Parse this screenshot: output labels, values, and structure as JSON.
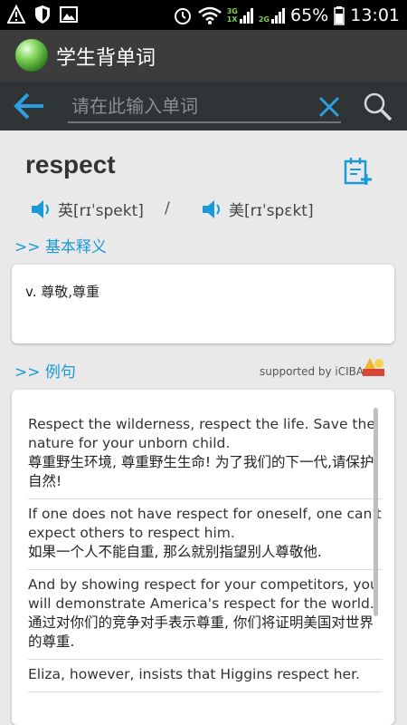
{
  "status_bar": {
    "network_label_top": "3G",
    "network_label_bottom": "1X",
    "network2_label_top": "2G",
    "battery": "65%",
    "time": "13:01"
  },
  "app": {
    "title": "学生背单词"
  },
  "search": {
    "placeholder": "请在此输入单词",
    "value": ""
  },
  "word": {
    "text": "respect",
    "pron_uk": "英[rɪˈspekt]",
    "pron_separator": "/",
    "pron_us": "美[rɪˈspɛkt]"
  },
  "sections": {
    "basic": ">> 基本释义",
    "examples": ">> 例句"
  },
  "definition": "v. 尊敬,尊重",
  "supported_by": "supported by iCIBA",
  "examples": [
    {
      "en": "Respect the wilderness, respect the life. Save the nature for your unborn child.",
      "zh": "尊重野生环境, 尊重野生生命! 为了我们的下一代,请保护自然!"
    },
    {
      "en": "If one does not have respect for oneself, one can't expect others to respect him.",
      "zh": "如果一个人不能自重, 那么就别指望别人尊敬他."
    },
    {
      "en": "And by showing respect for your competitors, you will demonstrate America's respect for the world.",
      "zh": "通过对你们的竞争对手表示尊重, 你们将证明美国对世界的尊重."
    },
    {
      "en": "Eliza, however, insists that Higgins respect her.",
      "zh": ""
    }
  ],
  "colors": {
    "accent": "#1a9ad6",
    "toolbar": "#3c3c3c",
    "searchbar": "#2f3436",
    "background": "#e9e9e9"
  }
}
